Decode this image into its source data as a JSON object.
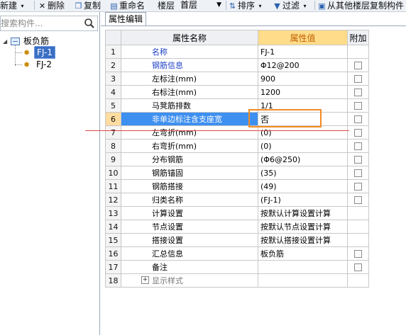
{
  "toolbar": {
    "new_label": "新建",
    "delete_label": "删除",
    "copy_label": "复制",
    "rename_label": "重命名",
    "floor_label": "楼层",
    "floor_value": "首层",
    "sort_label": "排序",
    "filter_label": "过滤",
    "copy_from_label": "从其他楼层复制构件"
  },
  "tree": {
    "search_placeholder": "搜索构件...",
    "root_label": "板负筋",
    "items": [
      {
        "label": "FJ-1",
        "selected": true
      },
      {
        "label": "FJ-2",
        "selected": false
      }
    ]
  },
  "panel": {
    "tab_label": "属性编辑",
    "headers": {
      "num": "",
      "name": "属性名称",
      "value": "属性值",
      "extra": "附加"
    }
  },
  "rows": [
    {
      "num": "1",
      "name": "名称",
      "value": "FJ-1",
      "blue": true,
      "checkbox": false
    },
    {
      "num": "2",
      "name": "钢筋信息",
      "value": "Φ12@200",
      "blue": true,
      "checkbox": true
    },
    {
      "num": "3",
      "name": "左标注(mm)",
      "value": "900",
      "blue": false,
      "checkbox": true
    },
    {
      "num": "4",
      "name": "右标注(mm)",
      "value": "1200",
      "blue": false,
      "checkbox": true
    },
    {
      "num": "5",
      "name": "马凳筋排数",
      "value": "1/1",
      "blue": false,
      "checkbox": true
    },
    {
      "num": "6",
      "name": "非单边标注含支座宽",
      "value": "否",
      "blue": false,
      "checkbox": true,
      "highlight": true
    },
    {
      "num": "7",
      "name": "左弯折(mm)",
      "value": "(0)",
      "blue": false,
      "checkbox": true
    },
    {
      "num": "8",
      "name": "右弯折(mm)",
      "value": "(0)",
      "blue": false,
      "checkbox": true
    },
    {
      "num": "9",
      "name": "分布钢筋",
      "value": "(Φ6@250)",
      "blue": false,
      "checkbox": true
    },
    {
      "num": "10",
      "name": "钢筋锚固",
      "value": "(35)",
      "blue": false,
      "checkbox": true
    },
    {
      "num": "11",
      "name": "钢筋搭接",
      "value": "(49)",
      "blue": false,
      "checkbox": true
    },
    {
      "num": "12",
      "name": "归类名称",
      "value": "(FJ-1)",
      "blue": false,
      "checkbox": true
    },
    {
      "num": "13",
      "name": "计算设置",
      "value": "按默认计算设置计算",
      "blue": false,
      "checkbox": false
    },
    {
      "num": "14",
      "name": "节点设置",
      "value": "按默认节点设置计算",
      "blue": false,
      "checkbox": false
    },
    {
      "num": "15",
      "name": "搭接设置",
      "value": "按默认搭接设置计算",
      "blue": false,
      "checkbox": false
    },
    {
      "num": "16",
      "name": "汇总信息",
      "value": "板负筋",
      "blue": false,
      "checkbox": true
    },
    {
      "num": "17",
      "name": "备注",
      "value": "",
      "blue": false,
      "checkbox": true
    },
    {
      "num": "18",
      "name": "显示样式",
      "value": "",
      "blue": false,
      "checkbox": false,
      "expander": true
    }
  ],
  "colors": {
    "accent_orange": "#f28b22",
    "highlight_blue": "#3d8ff0",
    "link_blue": "#1a3cc4",
    "annotation_red": "#e04a4a"
  }
}
